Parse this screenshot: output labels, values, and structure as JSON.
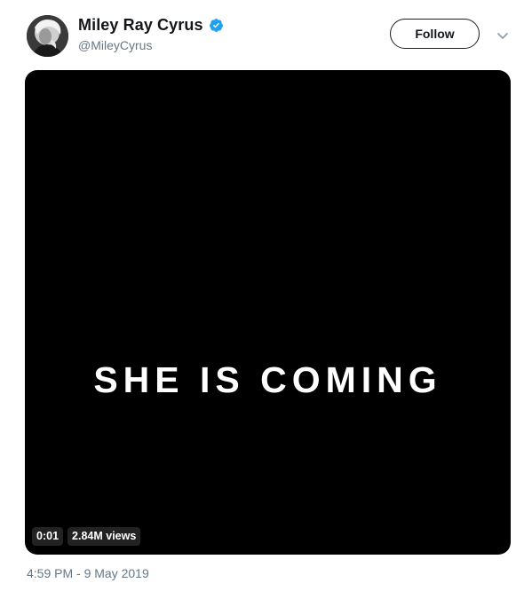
{
  "tweet": {
    "author": {
      "display_name": "Miley Ray Cyrus",
      "handle": "@MileyCyrus",
      "verified": true,
      "avatar_icon": "profile-photo"
    },
    "follow_label": "Follow",
    "menu_icon": "chevron-down-icon",
    "media": {
      "type": "video",
      "overlay_text": "SHE IS COMING",
      "duration": "0:01",
      "views": "2.84M views"
    },
    "timestamp": "4:59 PM - 9 May 2019"
  },
  "colors": {
    "verified_blue": "#1da1f2",
    "secondary_text": "#657786",
    "primary_text": "#14171a",
    "media_background": "#000000"
  }
}
